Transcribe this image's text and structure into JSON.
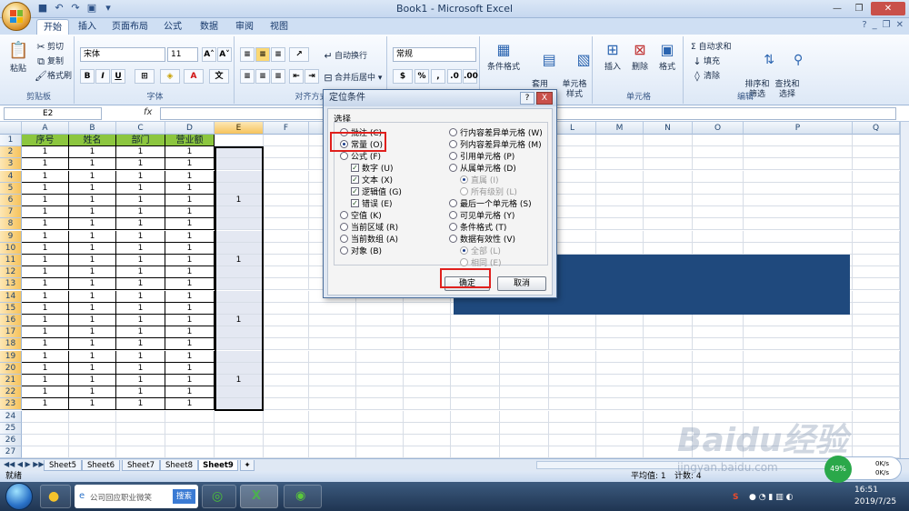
{
  "window": {
    "title": "Book1 - Microsoft Excel"
  },
  "tabs": [
    "开始",
    "插入",
    "页面布局",
    "公式",
    "数据",
    "审阅",
    "视图"
  ],
  "ribbon": {
    "clipboard": {
      "paste": "粘贴",
      "cut": "剪切",
      "copy": "复制",
      "format_painter": "格式刷",
      "label": "剪贴板"
    },
    "font": {
      "name": "宋体",
      "size": "11",
      "bold": "B",
      "italic": "I",
      "underline": "U",
      "label": "字体"
    },
    "alignment": {
      "wrap": "自动换行",
      "merge": "合并后居中",
      "label": "对齐方式"
    },
    "number": {
      "format": "常规",
      "percent": "%",
      "label": "数字"
    },
    "styles": {
      "conditional": "条件格式",
      "table": "套用\n表格格式",
      "cell": "单元格\n样式"
    },
    "cells": {
      "insert": "插入",
      "delete": "删除",
      "format": "格式",
      "label": "单元格"
    },
    "editing": {
      "autosum": "Σ 自动求和",
      "fill": "填充",
      "clear": "清除",
      "sort": "排序和\n筛选",
      "find": "查找和\n选择",
      "label": "编辑"
    }
  },
  "formula_bar": {
    "name_box": "E2",
    "fx": "fx",
    "value": ""
  },
  "columns": [
    "A",
    "B",
    "C",
    "D",
    "E",
    "F",
    "G",
    "H",
    "I",
    "J",
    "K",
    "L",
    "M",
    "N",
    "O",
    "P",
    "Q"
  ],
  "headers": [
    "序号",
    "姓名",
    "部门",
    "营业额"
  ],
  "rows": {
    "count": 27,
    "data_rows": 22,
    "cell_value": "1"
  },
  "e_values": [
    {
      "row": 6,
      "value": "1"
    },
    {
      "row": 11,
      "value": "1"
    },
    {
      "row": 16,
      "value": "1"
    },
    {
      "row": 21,
      "value": "1"
    }
  ],
  "sheets": [
    "Sheet5",
    "Sheet6",
    "Sheet7",
    "Sheet8",
    "Sheet9"
  ],
  "status": {
    "ready": "就绪",
    "avg": "平均值: 1",
    "count": "计数: 4"
  },
  "dialog": {
    "title": "定位条件",
    "help": "?",
    "close": "X",
    "section": "选择",
    "left_options": [
      {
        "label": "批注 (C)",
        "type": "radio",
        "checked": false
      },
      {
        "label": "常量 (O)",
        "type": "radio",
        "checked": true
      },
      {
        "label": "公式 (F)",
        "type": "radio",
        "checked": false
      },
      {
        "label": "数字 (U)",
        "type": "check",
        "checked": true,
        "indent": true
      },
      {
        "label": "文本 (X)",
        "type": "check",
        "checked": true,
        "indent": true
      },
      {
        "label": "逻辑值 (G)",
        "type": "check",
        "checked": true,
        "indent": true
      },
      {
        "label": "错误 (E)",
        "type": "check",
        "checked": true,
        "indent": true
      },
      {
        "label": "空值 (K)",
        "type": "radio",
        "checked": false
      },
      {
        "label": "当前区域 (R)",
        "type": "radio",
        "checked": false
      },
      {
        "label": "当前数组 (A)",
        "type": "radio",
        "checked": false
      },
      {
        "label": "对象 (B)",
        "type": "radio",
        "checked": false
      }
    ],
    "right_options": [
      {
        "label": "行内容差异单元格 (W)",
        "type": "radio",
        "checked": false
      },
      {
        "label": "列内容差异单元格 (M)",
        "type": "radio",
        "checked": false
      },
      {
        "label": "引用单元格 (P)",
        "type": "radio",
        "checked": false
      },
      {
        "label": "从属单元格 (D)",
        "type": "radio",
        "checked": false
      },
      {
        "label": "直属 (I)",
        "type": "radio",
        "checked": true,
        "indent": true,
        "disabled": true
      },
      {
        "label": "所有级别 (L)",
        "type": "radio",
        "checked": false,
        "indent": true,
        "disabled": true
      },
      {
        "label": "最后一个单元格 (S)",
        "type": "radio",
        "checked": false
      },
      {
        "label": "可见单元格 (Y)",
        "type": "radio",
        "checked": false
      },
      {
        "label": "条件格式 (T)",
        "type": "radio",
        "checked": false
      },
      {
        "label": "数据有效性 (V)",
        "type": "radio",
        "checked": false
      },
      {
        "label": "全部 (L)",
        "type": "radio",
        "checked": true,
        "indent": true,
        "disabled": true
      },
      {
        "label": "相同 (E)",
        "type": "radio",
        "checked": false,
        "indent": true,
        "disabled": true
      }
    ],
    "ok": "确定",
    "cancel": "取消"
  },
  "taskbar": {
    "search_placeholder": "公司回应职业微笑",
    "search_btn": "搜索",
    "time": "16:51",
    "date": "2019/7/25",
    "speed_up": "0K/s",
    "speed_down": "0K/s",
    "battery": "49%"
  },
  "watermark": {
    "text": "Baidu经验",
    "url": "jingyan.baidu.com"
  }
}
